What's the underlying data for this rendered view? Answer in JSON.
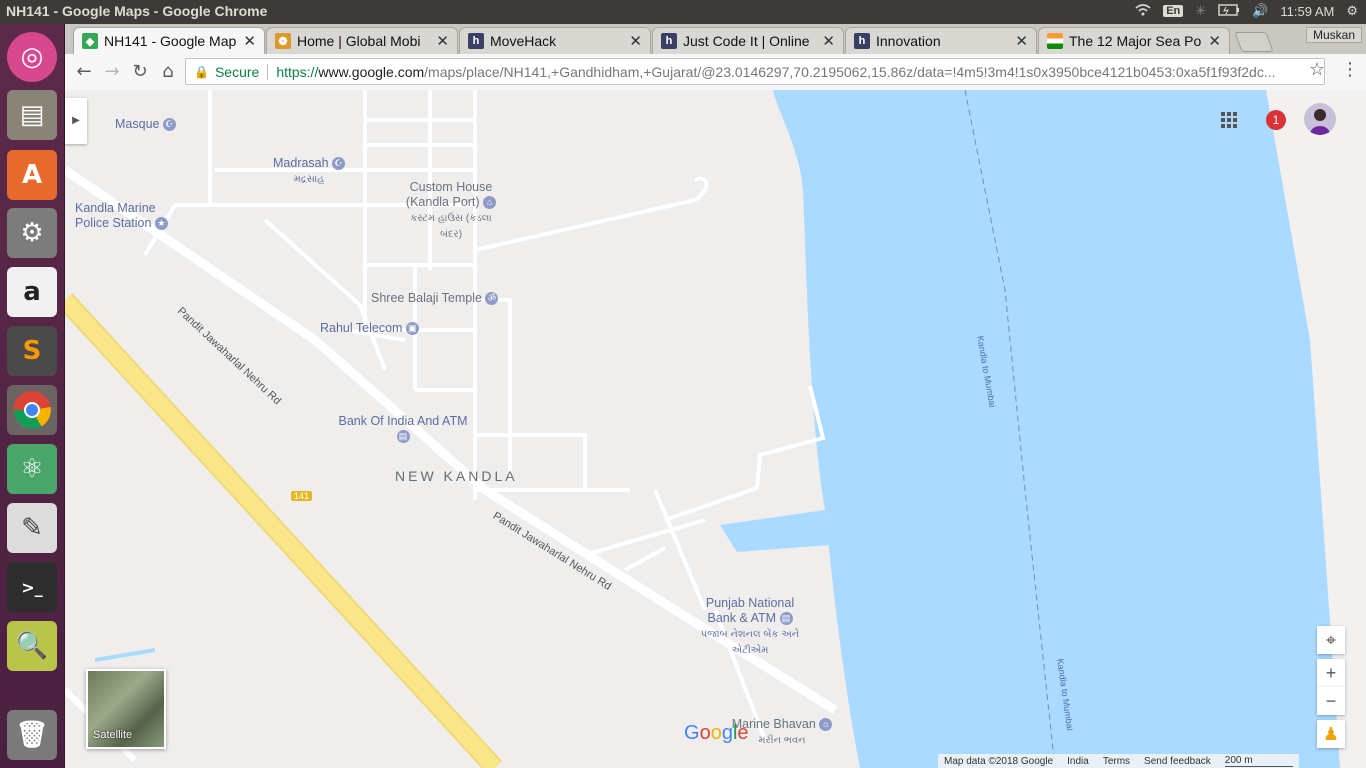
{
  "window": {
    "title": "NH141 - Google Maps - Google Chrome"
  },
  "tray": {
    "lang": "En",
    "time": "11:59 AM"
  },
  "launcher": {
    "apps": [
      "ubuntu-dash",
      "files",
      "software-center",
      "system-settings",
      "amazon",
      "sublime-text",
      "chrome",
      "atom",
      "text-editor",
      "terminal",
      "system-monitor",
      "trash"
    ]
  },
  "tabs": [
    {
      "label": "NH141 - Google Map",
      "favicon": "google-maps",
      "color": "#34a853"
    },
    {
      "label": "Home | Global Mobi",
      "favicon": "emblem",
      "color": "#d99a2b"
    },
    {
      "label": "MoveHack",
      "favicon": "h",
      "color": "#3a3f66"
    },
    {
      "label": "Just Code It | Online",
      "favicon": "h",
      "color": "#3a3f66"
    },
    {
      "label": "Innovation",
      "favicon": "h",
      "color": "#3a3f66"
    },
    {
      "label": "The 12 Major Sea Po",
      "favicon": "india-flag",
      "color": "#ff9933"
    }
  ],
  "profile": {
    "name": "Muskan"
  },
  "omnibox": {
    "secure_label": "Secure",
    "url_scheme": "https://",
    "url_host": "www.google.com",
    "url_rest": "/maps/place/NH141,+Gandhidham,+Gujarat/@23.0146297,70.2195062,15.86z/data=!4m5!3m4!1s0x3950bce4121b0453:0xa5f1f93f2dc..."
  },
  "map": {
    "pois": [
      {
        "name": "Masque",
        "local": ""
      },
      {
        "name": "Madrasah",
        "local": "મદ્રસાહ"
      },
      {
        "name": "Kandla Marine Police Station",
        "local": ""
      },
      {
        "name": "Custom House (Kandla Port)",
        "local": "કસ્ટમ હાઉસ (કંડલા બંદર)"
      },
      {
        "name": "Shree Balaji Temple",
        "local": ""
      },
      {
        "name": "Rahul Telecom",
        "local": ""
      },
      {
        "name": "Bank Of India And ATM",
        "local": ""
      },
      {
        "name": "Punjab National Bank & ATM",
        "local": "પંજાબ નેશનલ બેંક અને એટીએમ"
      },
      {
        "name": "Marine Bhavan",
        "local": "મરીન ભવન"
      }
    ],
    "area_label": "NEW KANDLA",
    "road_labels": [
      "Pandit Jawaharlal Nehru Rd",
      "Pandit Jawaharlal Nehru Rd"
    ],
    "highway_shield": "141",
    "ferry_labels": [
      "Kandla to Mumbai",
      "Kandla to Mumbai"
    ],
    "notifications": "1",
    "satellite_label": "Satellite",
    "zoom_in": "+",
    "zoom_out": "−",
    "footer": [
      "Map data ©2018 Google",
      "India",
      "Terms",
      "Send feedback",
      "200 m"
    ],
    "colors": {
      "water": "#aadaff",
      "land": "#efeeec",
      "highway": "#f8e688",
      "road": "#ffffff"
    }
  }
}
